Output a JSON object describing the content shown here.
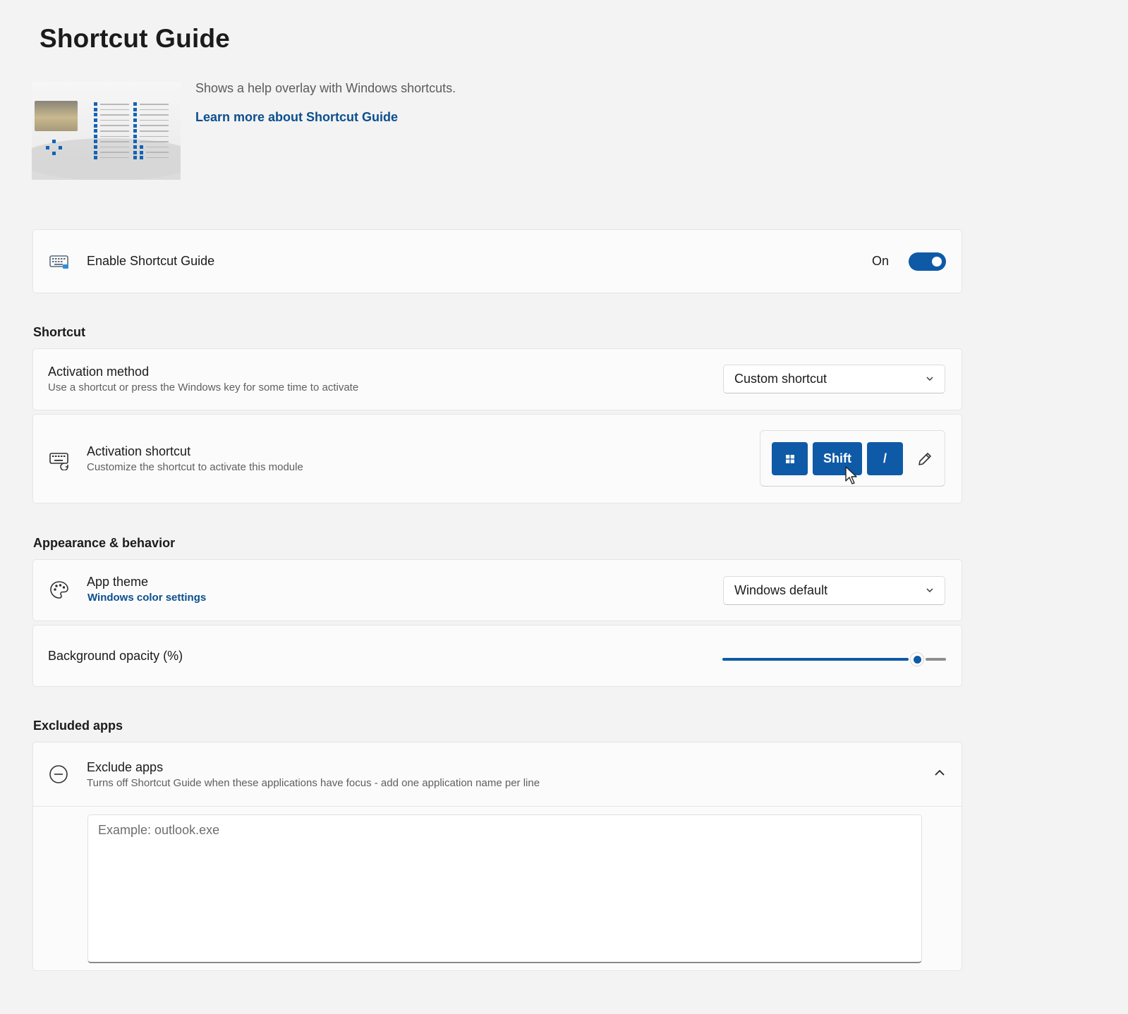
{
  "page": {
    "title": "Shortcut Guide"
  },
  "hero": {
    "description": "Shows a help overlay with Windows shortcuts.",
    "link_label": "Learn more about Shortcut Guide"
  },
  "enable": {
    "title": "Enable Shortcut Guide",
    "toggle_state": "On",
    "toggle_on": true,
    "icon": "keyboard-overlay-icon"
  },
  "sections": {
    "shortcut": "Shortcut",
    "appearance": "Appearance & behavior",
    "excluded": "Excluded apps"
  },
  "activation_method": {
    "title": "Activation method",
    "subtitle": "Use a shortcut or press the Windows key for some time to activate",
    "selected": "Custom shortcut",
    "icon": "chevron-down-icon"
  },
  "activation_shortcut": {
    "title": "Activation shortcut",
    "subtitle": "Customize the shortcut to activate this module",
    "keys": [
      "win",
      "Shift",
      "/"
    ],
    "icon": "keyboard-icon",
    "edit_icon": "pencil-icon"
  },
  "app_theme": {
    "title": "App theme",
    "link_label": "Windows color settings",
    "selected": "Windows default",
    "icon": "palette-icon"
  },
  "opacity": {
    "title": "Background opacity (%)",
    "value_fraction": 0.87
  },
  "exclude_apps": {
    "title": "Exclude apps",
    "subtitle": "Turns off Shortcut Guide when these applications have focus - add one application name per line",
    "placeholder": "Example: outlook.exe",
    "value": "",
    "icon": "minus-circle-icon",
    "expand_icon": "chevron-up-icon"
  },
  "colors": {
    "accent": "#0e5aa7",
    "link": "#0b4f8f",
    "background": "#f3f3f3",
    "card": "#fbfbfb"
  }
}
